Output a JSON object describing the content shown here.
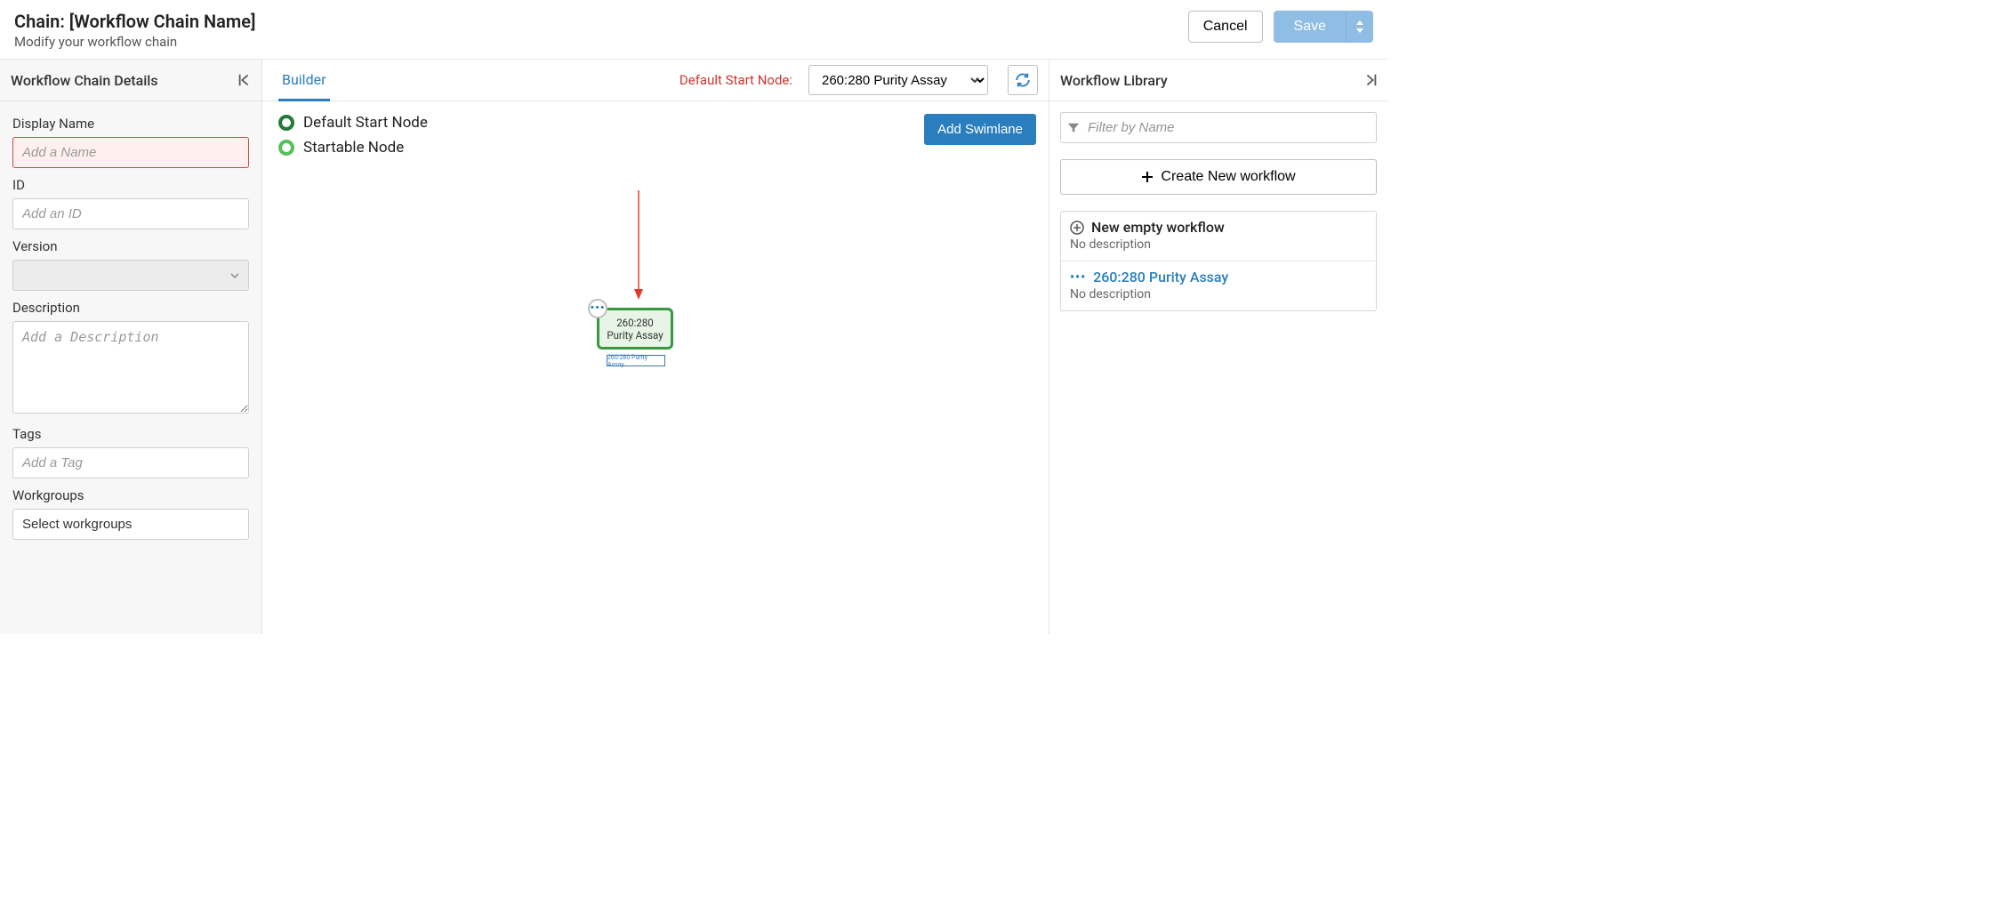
{
  "header": {
    "title": "Chain: [Workflow Chain Name]",
    "subtitle": "Modify your workflow chain",
    "cancel": "Cancel",
    "save": "Save"
  },
  "left": {
    "panel_title": "Workflow Chain Details",
    "display_name_label": "Display Name",
    "display_name_placeholder": "Add a Name",
    "id_label": "ID",
    "id_placeholder": "Add an ID",
    "version_label": "Version",
    "description_label": "Description",
    "description_placeholder": "Add a Description",
    "tags_label": "Tags",
    "tags_placeholder": "Add a Tag",
    "workgroups_label": "Workgroups",
    "workgroups_placeholder": "Select workgroups"
  },
  "mid": {
    "tab_builder": "Builder",
    "default_start_label": "Default Start Node:",
    "default_start_value": "260:280 Purity Assay",
    "legend_default": "Default Start Node",
    "legend_startable": "Startable Node",
    "add_swimlane": "Add Swimlane",
    "node_label": "260:280 Purity Assay",
    "node_sub_label": "260:280 Purity Assay"
  },
  "right": {
    "panel_title": "Workflow Library",
    "filter_placeholder": "Filter by Name",
    "create_label": "Create New workflow",
    "items": [
      {
        "title": "New empty workflow",
        "desc": "No description",
        "link": false
      },
      {
        "title": "260:280 Purity Assay",
        "desc": "No description",
        "link": true
      }
    ]
  }
}
